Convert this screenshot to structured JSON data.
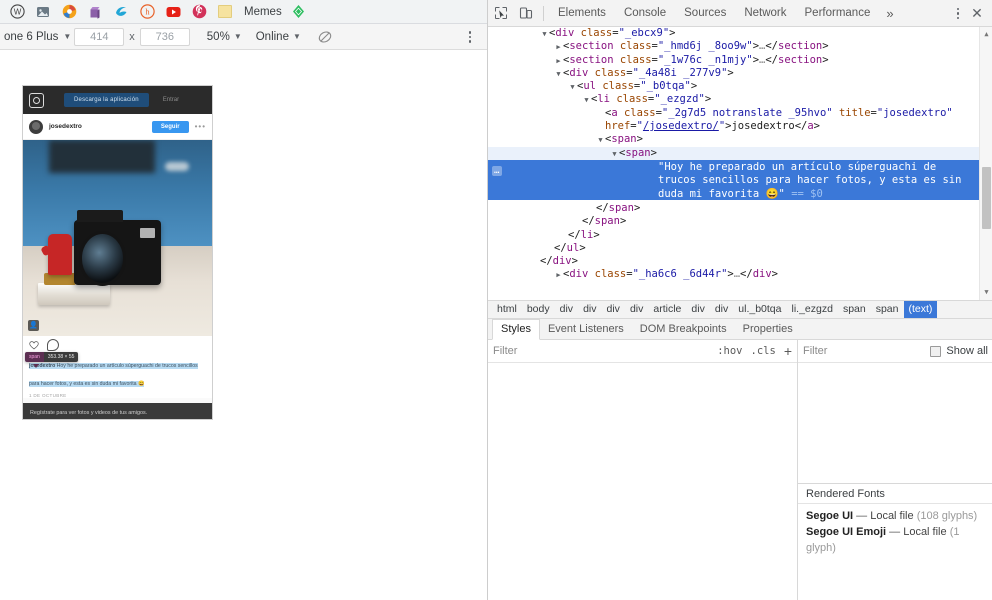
{
  "bookmarks": {
    "items": [
      {
        "name": "bookmark-icon-workplace",
        "label": "",
        "glyph": "W"
      },
      {
        "name": "bookmark-icon-photos",
        "label": "",
        "glyph": "photo"
      },
      {
        "name": "bookmark-icon-orange-circle",
        "label": "",
        "glyph": "circle"
      },
      {
        "name": "bookmark-icon-purple-bag",
        "label": "",
        "glyph": "bag"
      },
      {
        "name": "bookmark-icon-blue-swirl",
        "label": "",
        "glyph": "swirl"
      },
      {
        "name": "bookmark-icon-hootsuite",
        "label": "",
        "glyph": "h"
      },
      {
        "name": "bookmark-icon-youtube",
        "label": "",
        "glyph": "play"
      },
      {
        "name": "bookmark-icon-pinterest",
        "label": "",
        "glyph": "p"
      }
    ],
    "folder_label": "Memes",
    "last_icon": "evernote-icon"
  },
  "device_toolbar": {
    "device": "one 6 Plus",
    "width": "414",
    "height": "736",
    "times": "x",
    "zoom": "50%",
    "network": "Online",
    "throttle_icon": "no-throttling-icon",
    "more_icon": "kebab-menu-icon"
  },
  "phone": {
    "topbar": {
      "logo": "instagram-logo-icon",
      "download_button": "Descarga la aplicación",
      "login_label": "Entrar"
    },
    "userbar": {
      "username": "josedextro",
      "follow_button": "Seguir",
      "more": "•••"
    },
    "photo": {
      "alt": "camera-photo",
      "tag_icon": "tag-people-icon"
    },
    "actions": {
      "like": "heart-icon",
      "comment": "comment-bubble-icon"
    },
    "inspect_badge": {
      "element": "span",
      "size": "353.38 × 55"
    },
    "caption": {
      "username": "josedextro",
      "text": " Hoy he preparado un artículo súperguachi de trucos sencillos para hacer fotos, y esta es sin duda mi favorita 😄"
    },
    "date": "1 DE OCTUBRE",
    "footer": "Regístrate para ver fotos y videos de tus amigos."
  },
  "devtools": {
    "toolbar": {
      "inspect_icon": "inspect-element-icon",
      "device_icon": "toggle-device-toolbar-icon",
      "more_icon": "kebab-menu-icon",
      "close_icon": "close-icon"
    },
    "tabs": [
      {
        "label": "Elements",
        "active": true
      },
      {
        "label": "Console",
        "active": false
      },
      {
        "label": "Sources",
        "active": false
      },
      {
        "label": "Network",
        "active": false
      },
      {
        "label": "Performance",
        "active": false
      }
    ],
    "tabs_overflow": "»",
    "dom": {
      "lines": [
        {
          "indent": 3,
          "tri": "open",
          "content": "<div class=\"_ebcx9\">"
        },
        {
          "indent": 4,
          "tri": "closed",
          "content": "<section class=\"_hmd6j _8oo9w\">…</section>"
        },
        {
          "indent": 4,
          "tri": "closed",
          "content": "<section class=\"_1w76c _n1mjy\">…</section>"
        },
        {
          "indent": 4,
          "tri": "open",
          "content": "<div class=\"_4a48i _277v9\">"
        },
        {
          "indent": 5,
          "tri": "open",
          "content": "<ul class=\"_b0tqa\">"
        },
        {
          "indent": 6,
          "tri": "open",
          "content": "<li class=\"_ezgzd\">"
        },
        {
          "indent": 7,
          "tri": "none",
          "content": "<a class=\"_2g7d5 notranslate _95hvo\" title=\"josedextro\""
        },
        {
          "indent": 7,
          "tri": "none",
          "content": "href=\"/josedextro/\">josedextro</a>"
        },
        {
          "indent": 7,
          "tri": "open",
          "content": "<span>"
        },
        {
          "indent": 8,
          "tri": "open",
          "content": "<span>"
        }
      ],
      "selected_text": "\"Hoy he preparado un artículo súperguachi de trucos sencillos para hacer fotos, y esta es sin duda mi favorita 😄\"",
      "selected_suffix": "== $0",
      "closing_lines": [
        {
          "indent": 7,
          "content": "</span>"
        },
        {
          "indent": 6,
          "content": "</span>"
        },
        {
          "indent": 5,
          "content": "</li>"
        },
        {
          "indent": 4,
          "content": "</ul>"
        },
        {
          "indent": 3,
          "content": "</div>"
        },
        {
          "indent": 3,
          "content": "<div class=\"_ha6c6 _6d44r\">…</div>",
          "tri": "closed"
        }
      ]
    },
    "breadcrumbs": [
      {
        "label": "html",
        "active": false
      },
      {
        "label": "body",
        "active": false
      },
      {
        "label": "div",
        "active": false
      },
      {
        "label": "div",
        "active": false
      },
      {
        "label": "div",
        "active": false
      },
      {
        "label": "div",
        "active": false
      },
      {
        "label": "article",
        "active": false
      },
      {
        "label": "div",
        "active": false
      },
      {
        "label": "div",
        "active": false
      },
      {
        "label": "ul._b0tqa",
        "active": false
      },
      {
        "label": "li._ezgzd",
        "active": false
      },
      {
        "label": "span",
        "active": false
      },
      {
        "label": "span",
        "active": false
      },
      {
        "label": "(text)",
        "active": true
      }
    ],
    "sidebar_tabs": [
      {
        "label": "Styles",
        "active": true
      },
      {
        "label": "Event Listeners",
        "active": false
      },
      {
        "label": "DOM Breakpoints",
        "active": false
      },
      {
        "label": "Properties",
        "active": false
      }
    ],
    "styles_filter": {
      "placeholder": "Filter",
      "hov": ":hov",
      "cls": ".cls",
      "plus": "+"
    },
    "computed_filter": {
      "placeholder": "Filter",
      "show_all": "Show all"
    },
    "rendered_fonts": {
      "title": "Rendered Fonts",
      "entries": [
        {
          "name": "Segoe UI",
          "dash": "—",
          "source": "Local file",
          "glyphs": "(108 glyphs)"
        },
        {
          "name": "Segoe UI Emoji",
          "dash": "—",
          "source": "Local file",
          "glyphs": "(1 glyph)"
        }
      ]
    }
  },
  "annotation": {
    "arrow": "red-arrow-up",
    "color": "#e81d1d"
  }
}
